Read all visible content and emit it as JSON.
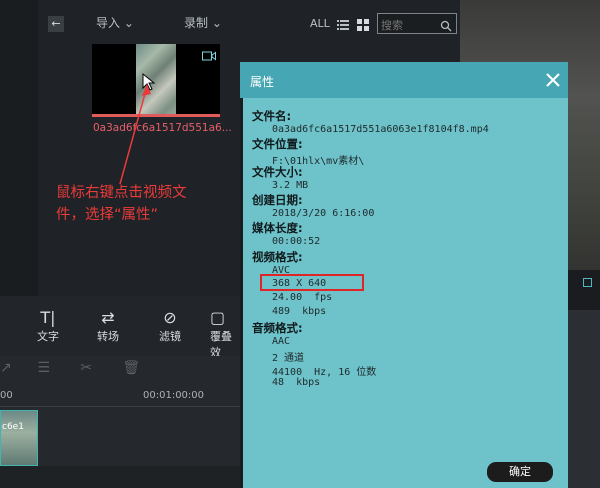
{
  "topbar": {
    "back_label": "←",
    "import_label": "导入",
    "record_label": "录制",
    "all_label": "ALL",
    "search_placeholder": "搜索"
  },
  "media": {
    "filename": "0a3ad6fc6a1517d551a6..."
  },
  "annotation": {
    "line1": "鼠标右键点击视频文",
    "line2": "件，选择“属性”"
  },
  "tools": {
    "text": "文字",
    "transition": "转场",
    "filter": "滤镜",
    "overlay": "覆叠效"
  },
  "timeline": {
    "tc_start": "00",
    "tc_one_min": "00:01:00:00",
    "clip_label": "c6e1"
  },
  "dialog": {
    "title": "属性",
    "close": "✕",
    "filename_label": "文件名:",
    "filename_value": "0a3ad6fc6a1517d551a6063e1f8104f8.mp4",
    "location_label": "文件位置:",
    "location_value": "F:\\01hlx\\mv素材\\",
    "size_label": "文件大小:",
    "size_value": "3.2 MB",
    "created_label": "创建日期:",
    "created_value": "2018/3/20 6:16:00",
    "duration_label": "媒体长度:",
    "duration_value": "00:00:52",
    "video_label": "视频格式:",
    "video_codec": "AVC",
    "video_resolution": "368 X 640",
    "video_fps": "24.00  fps",
    "video_bitrate": "489  kbps",
    "audio_label": "音频格式:",
    "audio_codec": "AAC",
    "audio_channels": "2 通道",
    "audio_sample": "44100  Hz, 16 位数",
    "audio_bitrate": "48  kbps",
    "ok_label": "确定"
  },
  "colors": {
    "dialog_bg": "#6ec2c9",
    "dialog_header": "#47a6b3",
    "accent_red": "#e02525",
    "filename_red": "#e6606a"
  }
}
